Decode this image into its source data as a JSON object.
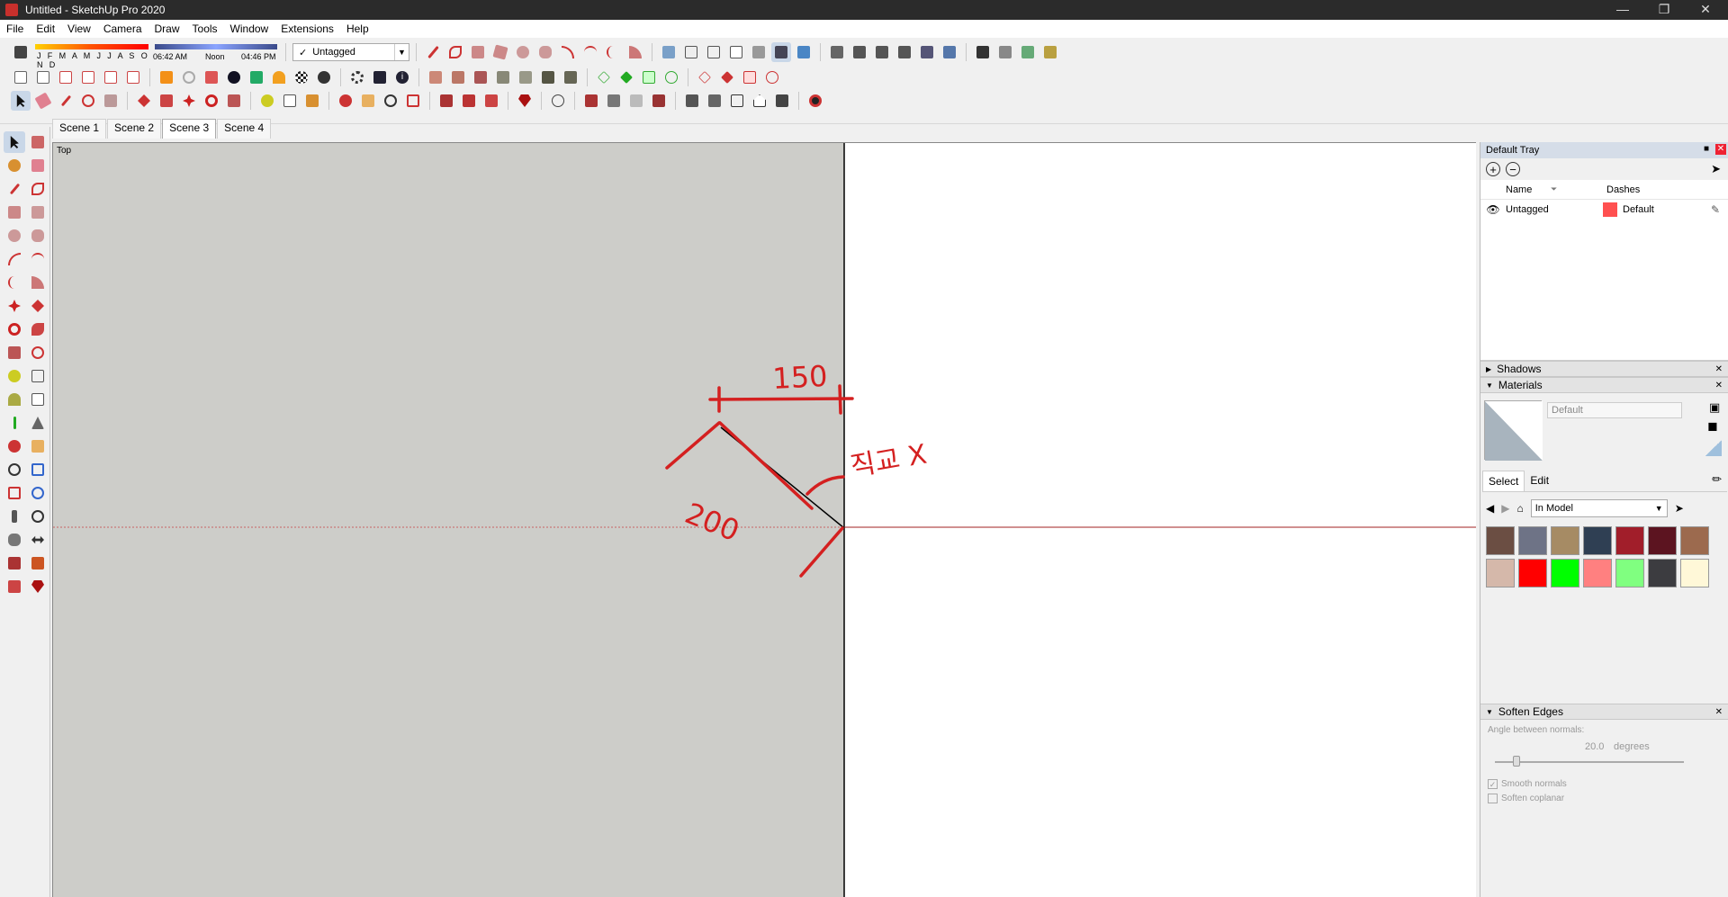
{
  "window": {
    "title": "Untitled - SketchUp Pro 2020",
    "controls": [
      "minimize",
      "restore",
      "close"
    ]
  },
  "menu": [
    "File",
    "Edit",
    "View",
    "Camera",
    "Draw",
    "Tools",
    "Window",
    "Extensions",
    "Help"
  ],
  "shadow_settings": {
    "months": "J F M A M J J A S O N D",
    "time_start": "06:42 AM",
    "time_mid": "Noon",
    "time_end": "04:46 PM"
  },
  "tag_dropdown": {
    "value": "Untagged"
  },
  "scenes": {
    "tabs": [
      "Scene 1",
      "Scene 2",
      "Scene 3",
      "Scene 4"
    ],
    "active": "Scene 3"
  },
  "viewport": {
    "view_name": "Top",
    "annotations": {
      "dim_top": "150",
      "dim_diag": "200",
      "note": "직교 X"
    },
    "colors": {
      "gray_region": "#cdcdc9",
      "annotation_red": "#d42020",
      "axis_red": "#c86464"
    }
  },
  "tray": {
    "title": "Default Tray",
    "tags": {
      "columns": {
        "name": "Name",
        "dashes": "Dashes"
      },
      "rows": [
        {
          "name": "Untagged",
          "color": "#ff5050",
          "dashes": "Default"
        }
      ]
    },
    "shadows": {
      "title": "Shadows"
    },
    "materials": {
      "title": "Materials",
      "current": "Default",
      "tab_select": "Select",
      "tab_edit": "Edit",
      "collection": "In Model",
      "swatches": [
        "#6b4e43",
        "#6e7386",
        "#a68b64",
        "#2f3f53",
        "#a11e2a",
        "#5c1420",
        "#9c6a4e",
        "#d5b8aa",
        "#ff0000",
        "#00ff00",
        "#ff8080",
        "#80ff80",
        "#3c3c40",
        "#fff8d8"
      ]
    },
    "soften": {
      "title": "Soften Edges",
      "angle_label": "Angle between normals:",
      "angle_value": "20.0",
      "angle_unit": "degrees",
      "smooth_normals": "Smooth normals",
      "soften_coplanar": "Soften coplanar"
    }
  }
}
